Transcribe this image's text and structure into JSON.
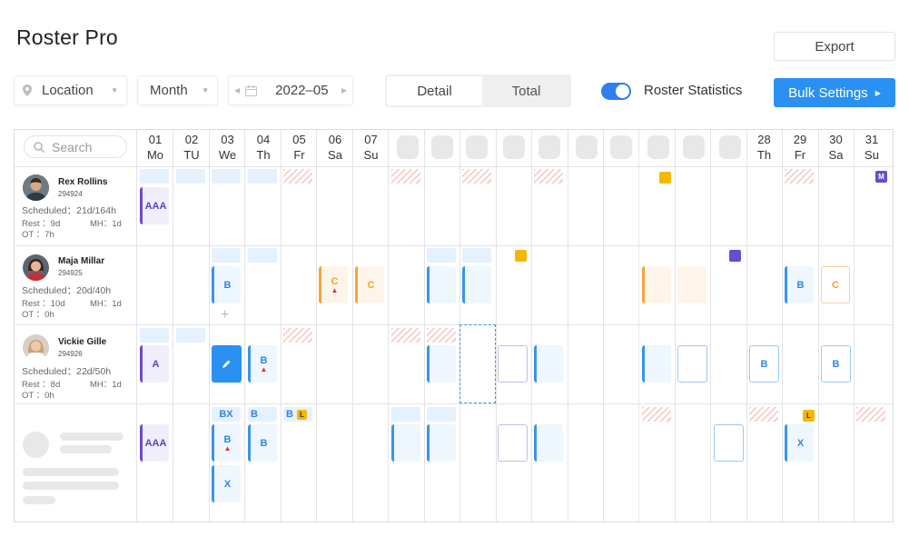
{
  "app_title": "Roster Pro",
  "toolbar": {
    "export_label": "Export",
    "location_placeholder": "Location",
    "period_value": "Month",
    "date_value": "2022–05",
    "tabs": [
      "Detail",
      "Total"
    ],
    "active_tab": "Detail",
    "roster_statistics_label": "Roster Statistics",
    "roster_statistics_on": true,
    "bulk_settings_label": "Bulk Settings"
  },
  "search_placeholder": "Search",
  "days": [
    {
      "num": "01",
      "dow": "Mo"
    },
    {
      "num": "02",
      "dow": "TU"
    },
    {
      "num": "03",
      "dow": "We"
    },
    {
      "num": "04",
      "dow": "Th"
    },
    {
      "num": "05",
      "dow": "Fr"
    },
    {
      "num": "06",
      "dow": "Sa"
    },
    {
      "num": "07",
      "dow": "Su"
    },
    {
      "num": "28",
      "dow": "Th"
    },
    {
      "num": "29",
      "dow": "Fr"
    },
    {
      "num": "30",
      "dow": "Sa"
    },
    {
      "num": "31",
      "dow": "Su"
    }
  ],
  "employees": [
    {
      "name": "Rex Rollins",
      "id": "294924",
      "scheduled": "Scheduled：21d/164h",
      "rest": "Rest ：9d",
      "mh": "MH：1d",
      "ot": "OT ：7h"
    },
    {
      "name": "Maja Millar",
      "id": "294925",
      "scheduled": "Scheduled：20d/40h",
      "rest": "Rest ：10d",
      "mh": "MH：1d",
      "ot": "OT ：0h"
    },
    {
      "name": "Vickie Gille",
      "id": "294926",
      "scheduled": "Scheduled：22d/50h",
      "rest": "Rest ：8d",
      "mh": "MH：1d",
      "ot": "OT ：0h"
    }
  ],
  "shift_codes": {
    "aaa": "AAA",
    "a": "A",
    "b": "B",
    "c": "C",
    "x": "X",
    "bx": "BX",
    "l": "L",
    "m": "M"
  },
  "colors": {
    "accent": "#2a90f2",
    "shift_blue": "#3a93ee",
    "shift_purple": "#6a4bd0",
    "shift_orange": "#f3a53b",
    "marker_yellow": "#f5b800",
    "marker_purple": "#6a4bd0"
  }
}
